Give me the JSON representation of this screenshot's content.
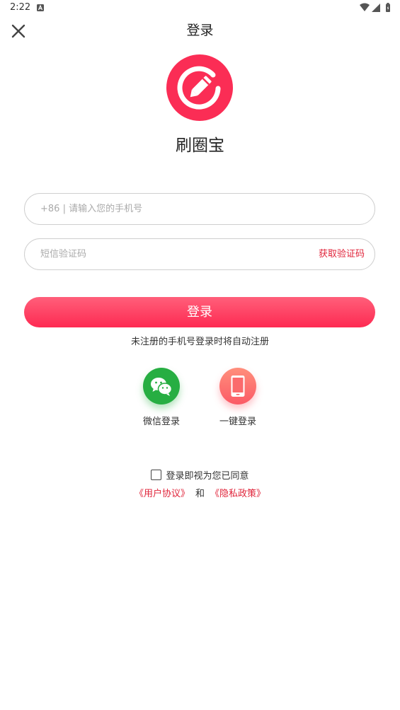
{
  "status_bar": {
    "time": "2:22"
  },
  "header": {
    "title": "登录"
  },
  "app": {
    "name": "刷圈宝",
    "brand_color": "#fb2d55"
  },
  "form": {
    "phone_placeholder": "+86 | 请输入您的手机号",
    "code_placeholder": "短信验证码",
    "get_code_label": "获取验证码",
    "login_label": "登录",
    "auto_register_note": "未注册的手机号登录时将自动注册"
  },
  "quick_login": [
    {
      "label": "微信登录",
      "icon": "wechat-icon",
      "color": "#27ae42"
    },
    {
      "label": "一键登录",
      "icon": "phone-icon",
      "color": "#fb5a66"
    }
  ],
  "agreement": {
    "text": "登录即视为您已同意",
    "user_agreement": "《用户协议》",
    "and": "和",
    "privacy_policy": "《隐私政策》",
    "accent_color": "#e0243a"
  }
}
